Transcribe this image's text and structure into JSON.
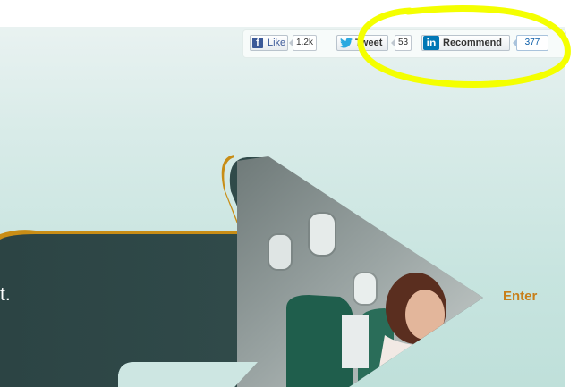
{
  "social": {
    "facebook": {
      "label": "Like",
      "count": "1.2k"
    },
    "twitter": {
      "label": "Tweet",
      "count": "53"
    },
    "linkedin": {
      "label": "Recommend",
      "count": "377"
    }
  },
  "hero": {
    "text_fragment": "t.",
    "enter_label": "Enter"
  },
  "colors": {
    "accent_orange": "#c87f1a",
    "panel_dark": "#2f4a4a",
    "annotation_yellow": "#f4ff00",
    "seat_green": "#1f5e4c"
  },
  "icons": [
    "facebook-icon",
    "twitter-bird-icon",
    "linkedin-icon"
  ]
}
